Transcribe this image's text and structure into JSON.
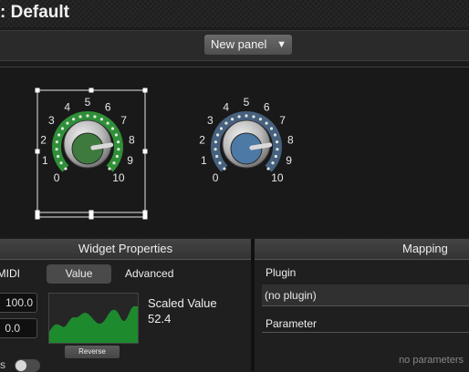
{
  "window": {
    "title": ": Default"
  },
  "toolbar": {
    "panel_select": "New panel"
  },
  "knobs": [
    {
      "labels": [
        "0",
        "1",
        "2",
        "3",
        "4",
        "5",
        "6",
        "7",
        "8",
        "9",
        "10"
      ],
      "accent": "#2f8f38",
      "cap": "#3e7a3e",
      "selected": true,
      "level": 0.8
    },
    {
      "labels": [
        "0",
        "1",
        "2",
        "3",
        "4",
        "5",
        "6",
        "7",
        "8",
        "9",
        "10"
      ],
      "accent": "#46607e",
      "cap": "#4d79a6",
      "selected": false,
      "level": 0.8
    }
  ],
  "widget_properties": {
    "header": "Widget Properties",
    "tabs": {
      "midi": "MIDI",
      "value": "Value",
      "advanced": "Advanced"
    },
    "max_value": "100.0",
    "min_value": "0.0",
    "reverse_label": "Reverse",
    "scaled_value_label": "Scaled Value",
    "scaled_value": "52.4",
    "toggle_label": "s",
    "curve_color": "#1e8a2e"
  },
  "mapping": {
    "header": "Mapping",
    "plugin_label": "Plugin",
    "plugin_value": "(no plugin)",
    "parameter_label": "Parameter",
    "empty_text": "no parameters"
  }
}
